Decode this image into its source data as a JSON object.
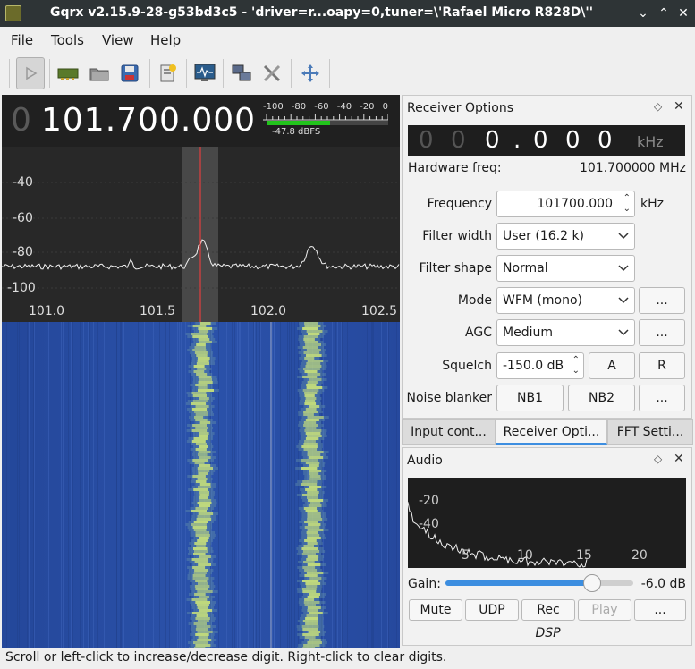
{
  "window": {
    "title": "Gqrx v2.15.9-28-g53bd3c5 - 'driver=r...oapy=0,tuner=\\'Rafael Micro R828D\\''",
    "controls": [
      "⌄",
      "⌃",
      "✕"
    ]
  },
  "menubar": {
    "items": [
      "File",
      "Tools",
      "View",
      "Help"
    ]
  },
  "toolbar": {
    "icons": [
      "play-icon",
      "device-icon",
      "open-icon",
      "save-icon",
      "bookmark-icon",
      "monitor-icon",
      "network-icon",
      "tools-icon",
      "dock-move-icon"
    ]
  },
  "display": {
    "freq_lead": "0",
    "frequency": "101.700.000",
    "meter_ticks": [
      "-100",
      "-80",
      "-60",
      "-40",
      "-20",
      "0"
    ],
    "meter_readout": "-47.8 dBFS",
    "meter_level_dbfs": -47.8,
    "db_ticks": [
      "-40",
      "-60",
      "-80",
      "-100"
    ],
    "freq_ticks": [
      "101.0",
      "101.5",
      "102.0",
      "102.5"
    ],
    "colors": {
      "waterfall_bg": "#2a4fa6",
      "signal": "#c8e07a",
      "marker": "#ff3b3b"
    }
  },
  "receiver": {
    "title": "Receiver Options",
    "offset_digits": [
      "0",
      "0",
      "0",
      ".",
      "0",
      "0",
      "0"
    ],
    "offset_unit": "kHz",
    "hw_label": "Hardware freq:",
    "hw_value": "101.700000 MHz",
    "freq_label": "Frequency",
    "freq_value": "101700.000",
    "freq_unit": "kHz",
    "filter_width_label": "Filter width",
    "filter_width": "User (16.2 k)",
    "filter_shape_label": "Filter shape",
    "filter_shape": "Normal",
    "mode_label": "Mode",
    "mode": "WFM (mono)",
    "agc_label": "AGC",
    "agc": "Medium",
    "squelch_label": "Squelch",
    "squelch": "-150.0 dB",
    "squelch_a": "A",
    "squelch_r": "R",
    "nb_label": "Noise blanker",
    "nb1": "NB1",
    "nb2": "NB2",
    "more": "..."
  },
  "tabs": [
    "Input cont...",
    "Receiver Opti...",
    "FFT Setti..."
  ],
  "audio": {
    "title": "Audio",
    "db_ticks": [
      "-20",
      "-40"
    ],
    "khz_ticks": [
      "5",
      "10",
      "15",
      "20"
    ],
    "gain_label": "Gain:",
    "gain_value": "-6.0 dB",
    "gain_fraction": 0.78,
    "buttons": [
      "Mute",
      "UDP",
      "Rec",
      "Play",
      "..."
    ],
    "dsp": "DSP"
  },
  "status": "Scroll or left-click to increase/decrease digit. Right-click to clear digits."
}
